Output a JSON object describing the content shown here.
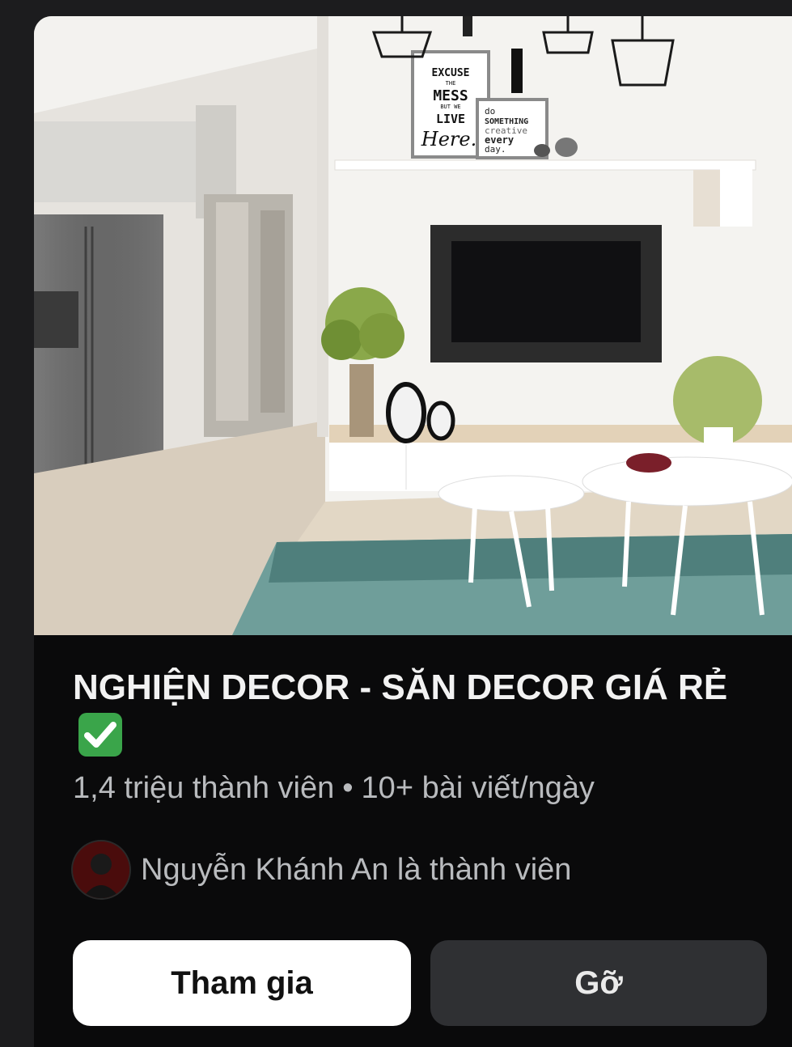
{
  "group": {
    "title": "NGHIỆN DECOR - SĂN DECOR GIÁ RẺ",
    "title_badge_icon": "check-mark-button-icon",
    "members": "1,4 triệu thành viên",
    "separator": "•",
    "activity": "10+ bài viết/ngày"
  },
  "cover": {
    "sign1_lines": [
      "EXCUSE",
      "THE",
      "MESS",
      "BUT WE",
      "LIVE",
      "Here."
    ],
    "sign2_lines": [
      "do",
      "SOMETHING",
      "creative",
      "every",
      "day."
    ]
  },
  "member_info": {
    "text": "Nguyễn Khánh An là thành viên"
  },
  "actions": {
    "join_label": "Tham gia",
    "remove_label": "Gỡ"
  },
  "colors": {
    "card_bg": "#0a0a0b",
    "page_bg": "#1c1c1e",
    "join_bg": "#ffffff",
    "remove_bg": "#2f3033",
    "badge_green": "#3aa54a"
  }
}
